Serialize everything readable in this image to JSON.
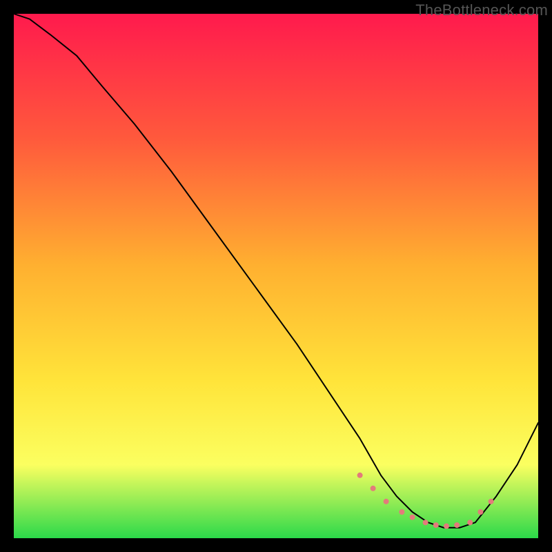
{
  "watermark": "TheBottleneck.com",
  "chart_data": {
    "type": "line",
    "title": "",
    "xlabel": "",
    "ylabel": "",
    "xlim": [
      0,
      100
    ],
    "ylim": [
      0,
      100
    ],
    "grid": false,
    "axes_visible": false,
    "background_gradient": {
      "stops": [
        {
          "offset": 0,
          "color": "#ff1a4d"
        },
        {
          "offset": 24,
          "color": "#ff5a3c"
        },
        {
          "offset": 48,
          "color": "#ffb030"
        },
        {
          "offset": 70,
          "color": "#ffe43a"
        },
        {
          "offset": 86,
          "color": "#fbff60"
        },
        {
          "offset": 100,
          "color": "#2bd94a"
        }
      ]
    },
    "series": [
      {
        "name": "curve",
        "color": "#000000",
        "stroke_width": 2,
        "x": [
          0,
          3,
          7,
          12,
          17,
          23,
          30,
          38,
          46,
          54,
          60,
          66,
          70,
          73,
          76,
          79,
          82,
          85,
          88,
          92,
          96,
          100
        ],
        "values": [
          100,
          99,
          96,
          92,
          86,
          79,
          70,
          59,
          48,
          37,
          28,
          19,
          12,
          8,
          5,
          3,
          2,
          2,
          3,
          8,
          14,
          22
        ]
      }
    ],
    "dotted_segments": [
      {
        "name": "floor-dots",
        "color": "#e37b7b",
        "radius": 4,
        "x": [
          66,
          68.5,
          71,
          74,
          76,
          78.5,
          80.5,
          82.5,
          84.5,
          87,
          89,
          91
        ],
        "values": [
          12,
          9.5,
          7,
          5,
          4,
          3,
          2.5,
          2.3,
          2.5,
          3,
          5,
          7
        ]
      }
    ]
  }
}
